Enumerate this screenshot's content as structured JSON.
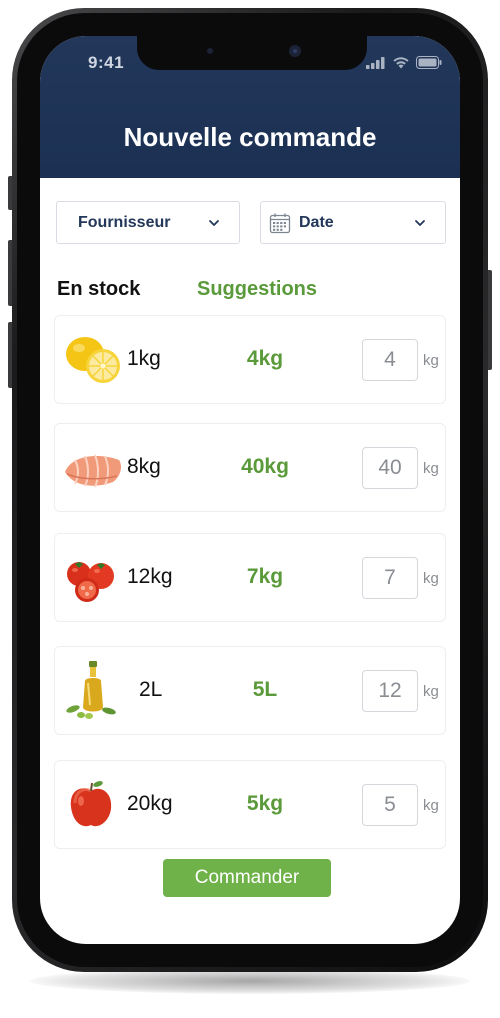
{
  "status_bar": {
    "time": "9:41",
    "icons": [
      "signal-icon",
      "wifi-icon",
      "battery-icon"
    ]
  },
  "header": {
    "title": "Nouvelle commande",
    "background_color": "#1b3053"
  },
  "filters": {
    "supplier_label": "Fournisseur",
    "date_label": "Date"
  },
  "columns": {
    "stock_label": "En stock",
    "suggestions_label": "Suggestions"
  },
  "items": [
    {
      "icon": "lemon-icon",
      "stock": "1kg",
      "suggestion": "4kg",
      "quantity": "4",
      "unit": "kg"
    },
    {
      "icon": "salmon-icon",
      "stock": "8kg",
      "suggestion": "40kg",
      "quantity": "40",
      "unit": "kg"
    },
    {
      "icon": "tomato-icon",
      "stock": "12kg",
      "suggestion": "7kg",
      "quantity": "7",
      "unit": "kg"
    },
    {
      "icon": "olive-oil-icon",
      "stock": "2L",
      "suggestion": "5L",
      "quantity": "12",
      "unit": "kg"
    },
    {
      "icon": "apple-icon",
      "stock": "20kg",
      "suggestion": "5kg",
      "quantity": "5",
      "unit": "kg"
    }
  ],
  "order_button": {
    "label": "Commander",
    "color": "#6fb249"
  },
  "colors": {
    "accent_green": "#5a9a3a",
    "navy": "#22375a"
  }
}
